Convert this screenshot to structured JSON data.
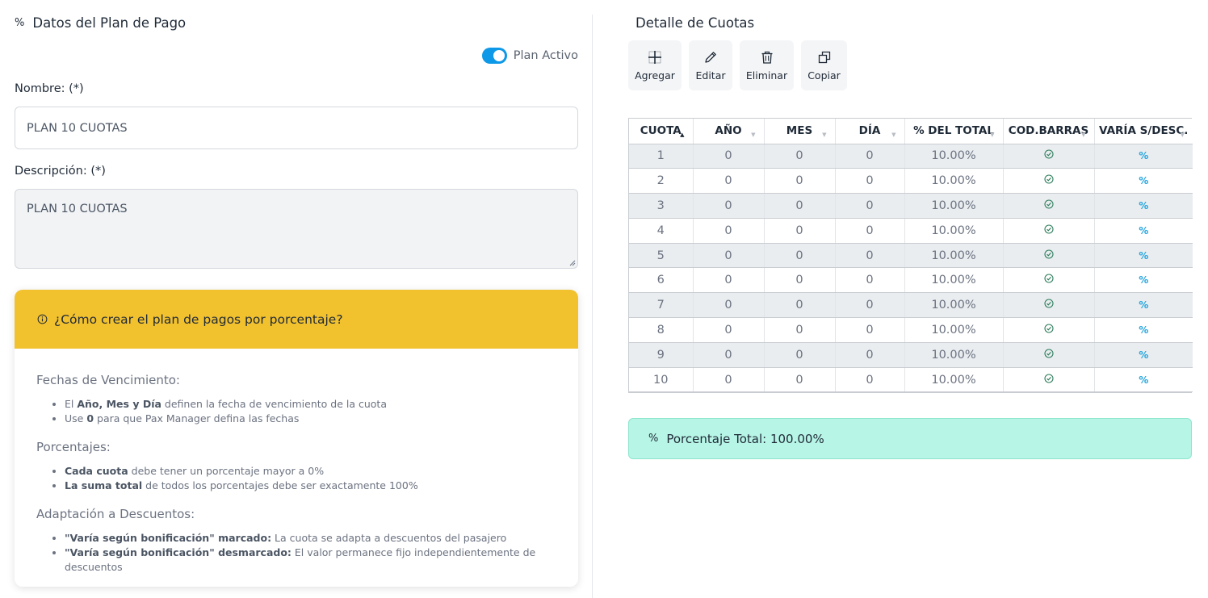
{
  "left_panel": {
    "title": "Datos del Plan de Pago",
    "title_icon": "%",
    "toggle_label": "Plan Activo",
    "name_label": "Nombre: (*)",
    "name_value": "PLAN 10 CUOTAS",
    "desc_label": "Descripción: (*)",
    "desc_value": "PLAN 10 CUOTAS",
    "help": {
      "title": "¿Cómo crear el plan de pagos por porcentaje?",
      "sections": [
        {
          "heading": "Fechas de Vencimiento:",
          "items": [
            {
              "pre": "El ",
              "bold": "Año, Mes y Día",
              "post": " definen la fecha de vencimiento de la cuota"
            },
            {
              "pre": "Use ",
              "bold": "0",
              "post": " para que Pax Manager defina las fechas"
            }
          ]
        },
        {
          "heading": "Porcentajes:",
          "items": [
            {
              "pre": "",
              "bold": "Cada cuota",
              "post": " debe tener un porcentaje mayor a 0%"
            },
            {
              "pre": "",
              "bold": "La suma total",
              "post": " de todos los porcentajes debe ser exactamente 100%"
            }
          ]
        },
        {
          "heading": "Adaptación a Descuentos:",
          "items": [
            {
              "pre": "",
              "bold": "\"Varía según bonificación\" marcado:",
              "post": " La cuota se adapta a descuentos del pasajero"
            },
            {
              "pre": "",
              "bold": "\"Varía según bonificación\" desmarcado:",
              "post": " El valor permanece fijo independientemente de descuentos"
            }
          ]
        }
      ]
    }
  },
  "right_panel": {
    "title": "Detalle de Cuotas",
    "toolbar": [
      {
        "label": "Agregar",
        "icon": "plus-icon",
        "name": "add-button"
      },
      {
        "label": "Editar",
        "icon": "pencil-icon",
        "name": "edit-button"
      },
      {
        "label": "Eliminar",
        "icon": "trash-icon",
        "name": "delete-button"
      },
      {
        "label": "Copiar",
        "icon": "copy-icon",
        "name": "copy-button"
      }
    ],
    "columns": [
      "CUOTA",
      "AÑO",
      "MES",
      "DÍA",
      "% DEL TOTAL",
      "COD.BARRAS",
      "VARÍA S/DESC."
    ],
    "rows": [
      [
        "1",
        "0",
        "0",
        "0",
        "10.00%"
      ],
      [
        "2",
        "0",
        "0",
        "0",
        "10.00%"
      ],
      [
        "3",
        "0",
        "0",
        "0",
        "10.00%"
      ],
      [
        "4",
        "0",
        "0",
        "0",
        "10.00%"
      ],
      [
        "5",
        "0",
        "0",
        "0",
        "10.00%"
      ],
      [
        "6",
        "0",
        "0",
        "0",
        "10.00%"
      ],
      [
        "7",
        "0",
        "0",
        "0",
        "10.00%"
      ],
      [
        "8",
        "0",
        "0",
        "0",
        "10.00%"
      ],
      [
        "9",
        "0",
        "0",
        "0",
        "10.00%"
      ],
      [
        "10",
        "0",
        "0",
        "0",
        "10.00%"
      ]
    ],
    "row_percent_icon": "%",
    "total_icon": "%",
    "total_text": "Porcentaje Total: 100.00%"
  },
  "colors": {
    "accent": "#0e98e8",
    "help_header": "#f2c12e",
    "total_bg": "#b7f5e6",
    "check": "#2e7d5b",
    "percent": "#26a7e0"
  }
}
